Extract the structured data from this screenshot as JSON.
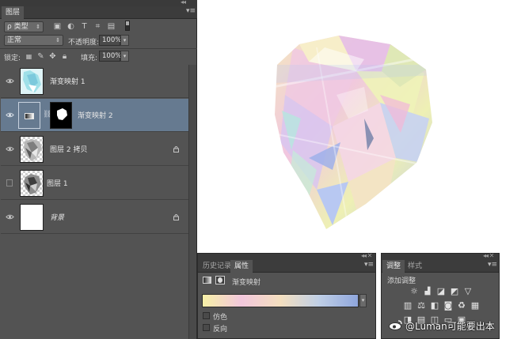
{
  "layers_panel": {
    "tab_label": "图层",
    "filter_label": "ρ 类型",
    "blend_mode": "正常",
    "opacity_label": "不透明度:",
    "opacity_value": "100%",
    "lock_label": "锁定:",
    "fill_label": "填充:",
    "fill_value": "100%",
    "layers": [
      {
        "name": "渐变映射 1",
        "visible": true
      },
      {
        "name": "渐变映射 2",
        "visible": true,
        "selected": true
      },
      {
        "name": "图层 2 拷贝",
        "visible": true,
        "locked": true
      },
      {
        "name": "图层 1",
        "visible": false
      },
      {
        "name": "背景",
        "visible": true,
        "locked": true
      }
    ]
  },
  "properties_panel": {
    "tabs": [
      "历史记录",
      "属性"
    ],
    "title": "渐变映射",
    "gradient_colors": [
      "#f6f0a6",
      "#f2c7dc",
      "#f4dfbf",
      "#bfcfe6",
      "#8fa6dc"
    ],
    "checkbox_dither": "仿色",
    "checkbox_reverse": "反向"
  },
  "adjustments_panel": {
    "tabs": [
      "调整",
      "样式"
    ],
    "title": "添加调整"
  },
  "watermark": {
    "text": "@Luman可能要出本"
  }
}
